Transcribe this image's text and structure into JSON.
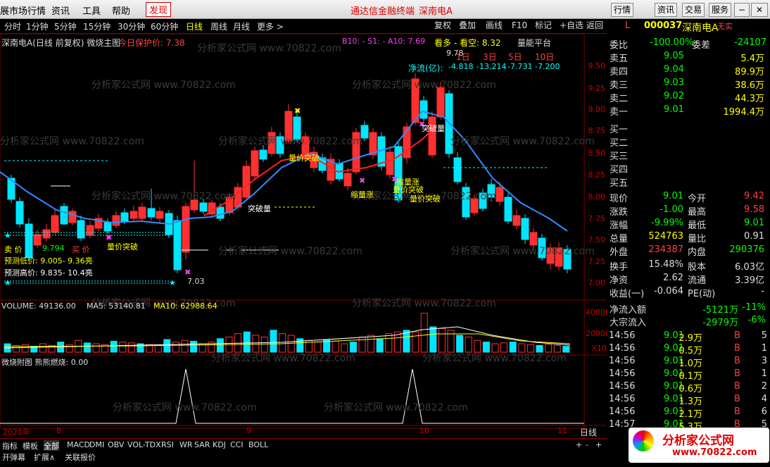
{
  "menu": {
    "market": "展市场行情",
    "news": "资讯",
    "tools": "工具",
    "help": "帮助",
    "discover": "发现",
    "app_title": "通达信金融终端",
    "stock_title": "深南电A",
    "right_tabs": [
      "行情",
      "资讯",
      "交易",
      "服务"
    ]
  },
  "periods": [
    "分时",
    "1分钟",
    "5分钟",
    "15分钟",
    "30分钟",
    "60分钟",
    "日线",
    "周线",
    "月线",
    "更多 >"
  ],
  "tools": [
    "复权",
    "叠加",
    "画线",
    "F10",
    "标记",
    "+自选",
    "返回"
  ],
  "chart_header": {
    "title": "深南电A(日线 前复权) 微烧主图",
    "protect": "今日保护价: 7.38",
    "indicator": "B10: -  S1: -  A10: 7.69",
    "look": "看多 - 看空: 8.32",
    "platform": "量能平台",
    "days": [
      "1日",
      "3日",
      "5日",
      "10日"
    ],
    "net_flow_label": "净流(亿):",
    "net_flow_values": [
      "-4.818",
      "-13.214",
      "-7.731",
      "-7.200"
    ]
  },
  "price_axis": [
    "9.50",
    "9.25",
    "9.00",
    "8.75",
    "8.50",
    "8.25",
    "8.00",
    "7.75",
    "7.50",
    "7.25",
    "7.00"
  ],
  "annotations": {
    "high": "9.78",
    "low": "7.03",
    "breakthrough": "突破量",
    "price_vol": "量价突破",
    "shrink": "缩量涨",
    "sell_label": "卖 价",
    "sell_value": "9.794",
    "buy_label": "买 价",
    "forecast_low": "预测低价: 9.005-  9.36亮",
    "forecast_high": "预测高价: 9.835-  10.4亮"
  },
  "volume": {
    "header": "VOLUME: 49136.00",
    "ma5": "MA5: 53140.81",
    "ma10": "MA10: 62988.64",
    "axis": [
      "40000",
      "20000",
      "X10"
    ]
  },
  "sub": {
    "header": "微烧附图 熊熊燃烧: 0.00"
  },
  "time_axis": [
    "2021年",
    "8",
    "9",
    "10",
    "11"
  ],
  "period_label": "日线",
  "indicator_tabs": [
    "指标",
    "模板",
    "全部",
    "MACD",
    "DMI",
    "OBV",
    "VOL-TDX",
    "RSI",
    "WR",
    "SAR",
    "KDJ",
    "CCI",
    "BOLL"
  ],
  "bottom_tabs": [
    "开弹幕",
    "扩展∧",
    "关联报价"
  ],
  "watermark": "分析家公式网 www.70822.com",
  "quote": {
    "code": "000037",
    "name": "深南电A",
    "tag": "无实",
    "wei_bi_label": "委比",
    "wei_bi": "-100.00%",
    "wei_cha_label": "委差",
    "wei_cha": "-24107",
    "sell": [
      {
        "label": "卖五",
        "price": "9.05",
        "vol": "5.4万"
      },
      {
        "label": "卖四",
        "price": "9.04",
        "vol": "89.9万"
      },
      {
        "label": "卖三",
        "price": "9.03",
        "vol": "38.6万"
      },
      {
        "label": "卖二",
        "price": "9.02",
        "vol": "44.3万"
      },
      {
        "label": "卖一",
        "price": "9.01",
        "vol": "1994.4万"
      }
    ],
    "buy": [
      "买一",
      "买二",
      "买三",
      "买四",
      "买五"
    ],
    "stats": [
      {
        "l1": "现价",
        "v1": "9.01",
        "l2": "今开",
        "v2": "9.42"
      },
      {
        "l1": "涨跌",
        "v1": "-1.00",
        "l2": "最高",
        "v2": "9.58"
      },
      {
        "l1": "涨幅",
        "v1": "-9.99%",
        "l2": "最低",
        "v2": "9.01"
      },
      {
        "l1": "总量",
        "v1": "524763",
        "l2": "量比",
        "v2": "0.91"
      },
      {
        "l1": "外盘",
        "v1": "234387",
        "l2": "内盘",
        "v2": "290376"
      }
    ],
    "stats2": [
      {
        "l1": "换手",
        "v1": "15.48%",
        "l2": "股本",
        "v2": "6.03亿"
      },
      {
        "l1": "净资",
        "v1": "2.62",
        "l2": "流通",
        "v2": "3.39亿"
      },
      {
        "l1": "收益(一)",
        "v1": "-0.064",
        "l2": "PE(动)",
        "v2": "-"
      }
    ],
    "flow": [
      {
        "label": "净流入额",
        "value": "-5121万",
        "pct": "-11%"
      },
      {
        "label": "大宗流入",
        "value": "-2979万",
        "pct": "-6%"
      }
    ],
    "ticks": [
      {
        "time": "14:56",
        "price": "9.01",
        "vol": "2.9万",
        "side": "B",
        "n": "5"
      },
      {
        "time": "14:56",
        "price": "9.01",
        "vol": "0.5万",
        "side": "B",
        "n": "1"
      },
      {
        "time": "14:56",
        "price": "9.01",
        "vol": "1.0万",
        "side": "B",
        "n": "3"
      },
      {
        "time": "14:56",
        "price": "9.01",
        "vol": "0.1万",
        "side": "B",
        "n": "1"
      },
      {
        "time": "14:56",
        "price": "9.01",
        "vol": "0.6万",
        "side": "B",
        "n": "2"
      },
      {
        "time": "14:56",
        "price": "9.01",
        "vol": "1.3万",
        "side": "B",
        "n": "4"
      },
      {
        "time": "14:56",
        "price": "9.01",
        "vol": "2.1万",
        "side": "B",
        "n": "6"
      },
      {
        "time": "14:57",
        "price": "9.01",
        "vol": "5.3万",
        "side": "B",
        "n": "5"
      }
    ],
    "corner": "L",
    "logo_text": "分析家公式网",
    "logo_url": "www.70822.com"
  }
}
